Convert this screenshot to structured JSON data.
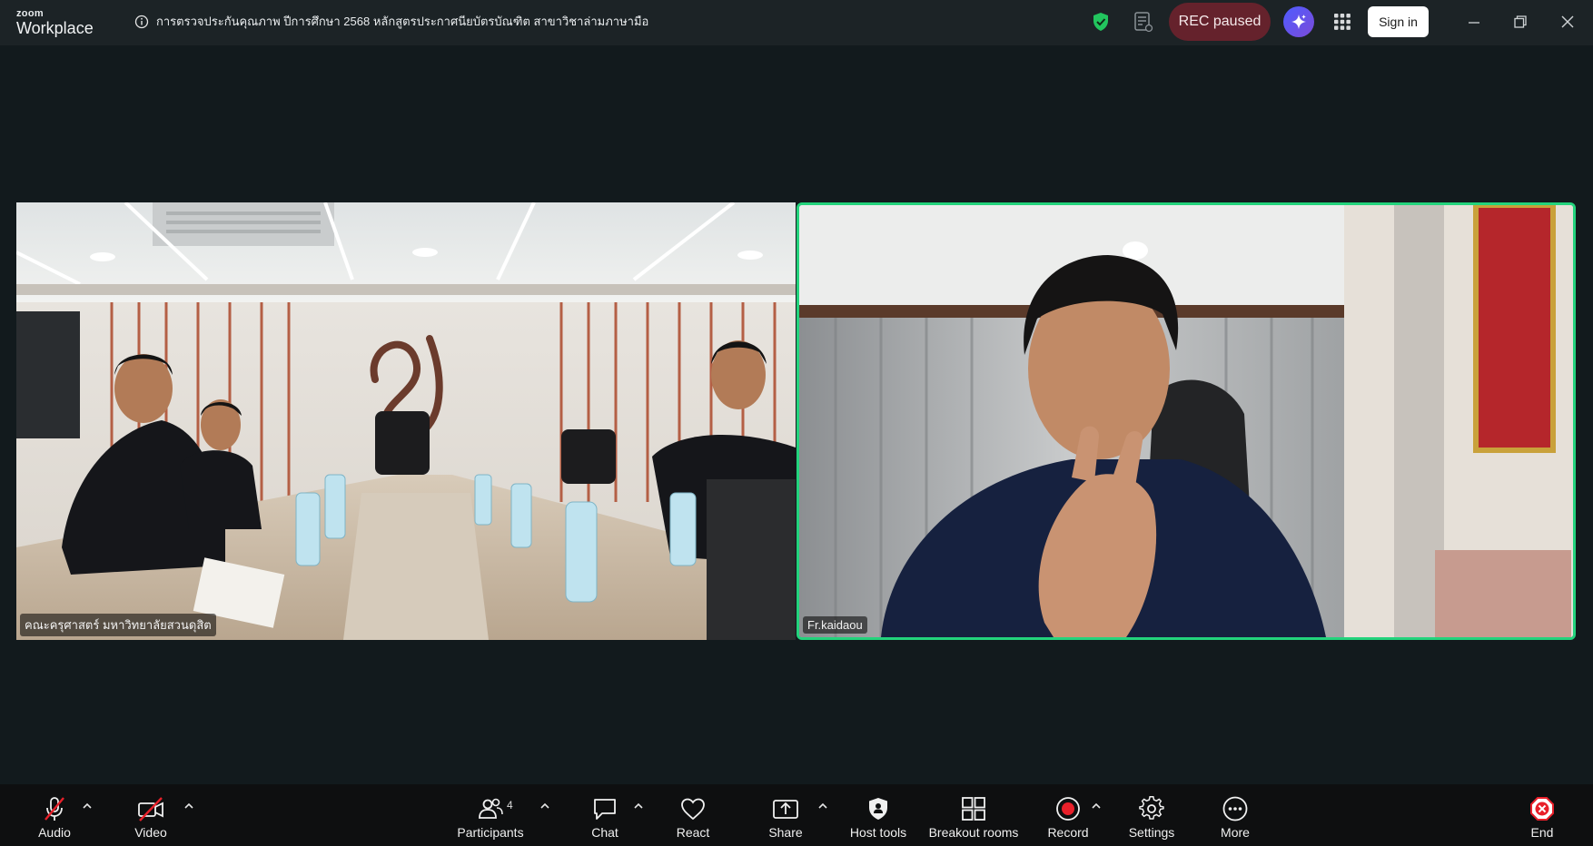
{
  "app": {
    "brand_top": "zoom",
    "brand_bottom": "Workplace"
  },
  "meeting": {
    "title": "การตรวจประกันคุณภาพ ปีการศึกษา 2568 หลักสูตรประกาศนียบัตรบัณฑิต สาขาวิชาล่ามภาษามือ"
  },
  "titlebar": {
    "rec_status": "REC paused",
    "sign_in": "Sign in"
  },
  "participants": [
    {
      "name": "คณะครุศาสตร์ มหาวิทยาลัยสวนดุสิต",
      "active_speaker": false
    },
    {
      "name": "Fr.kaidaou",
      "active_speaker": true
    }
  ],
  "toolbar": {
    "audio": "Audio",
    "video": "Video",
    "participants": "Participants",
    "participant_count": "4",
    "chat": "Chat",
    "react": "React",
    "share": "Share",
    "host_tools": "Host tools",
    "breakout_rooms": "Breakout rooms",
    "record": "Record",
    "settings": "Settings",
    "more": "More",
    "end": "End"
  },
  "colors": {
    "active_border": "#23d37c",
    "rec_pill": "#65222c",
    "record_dot": "#e8202a",
    "muted_slash": "#e8202a",
    "end_icon": "#e8202a"
  },
  "icons": [
    "info-icon",
    "shield-icon",
    "notes-icon",
    "ai-companion-icon",
    "apps-icon",
    "minimize-icon",
    "restore-icon",
    "close-icon",
    "microphone-muted-icon",
    "camera-off-icon",
    "participants-icon",
    "chat-icon",
    "heart-icon",
    "share-icon",
    "host-tools-icon",
    "breakout-rooms-icon",
    "record-icon",
    "gear-icon",
    "more-icon",
    "end-icon",
    "caret-up-icon"
  ]
}
